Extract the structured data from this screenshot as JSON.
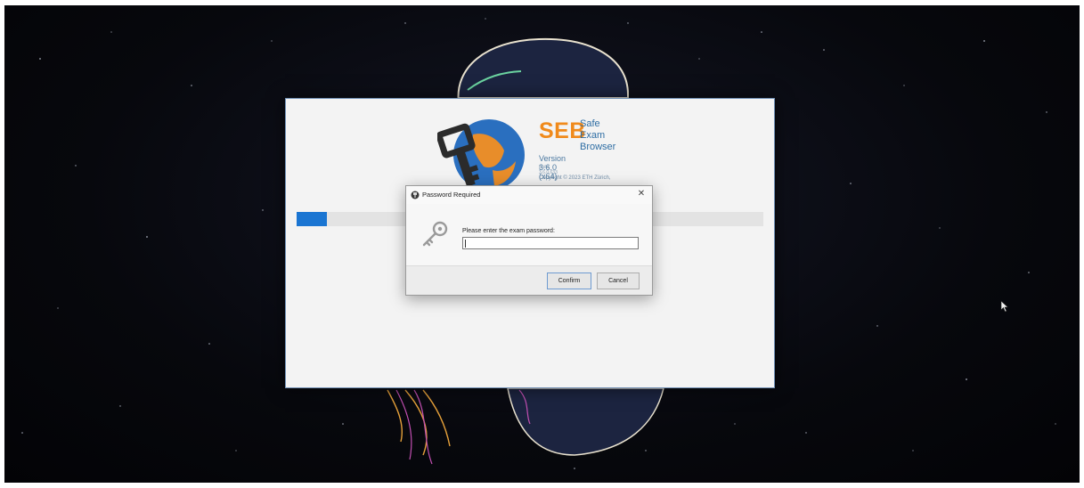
{
  "splash": {
    "brand": "SEB",
    "name_line1": "Safe",
    "name_line2": "Exam",
    "name_line3": "Browser",
    "version": "Version 3.6.0 (x64)",
    "build": "Build 3.6.0.633",
    "copyright": "Copyright © 2023 ETH Zürich,",
    "progress": 0.065,
    "colors": {
      "brand_orange": "#f08a1b",
      "text_blue": "#2f6ea4",
      "progress_blue": "#1a75d2"
    }
  },
  "dialog": {
    "title": "Password Required",
    "prompt": "Please enter the exam password:",
    "password_value": "",
    "confirm_label": "Confirm",
    "cancel_label": "Cancel",
    "close_glyph": "✕",
    "icons": {
      "app": "seb-app-icon",
      "key": "key-icon",
      "close": "close-icon"
    }
  }
}
